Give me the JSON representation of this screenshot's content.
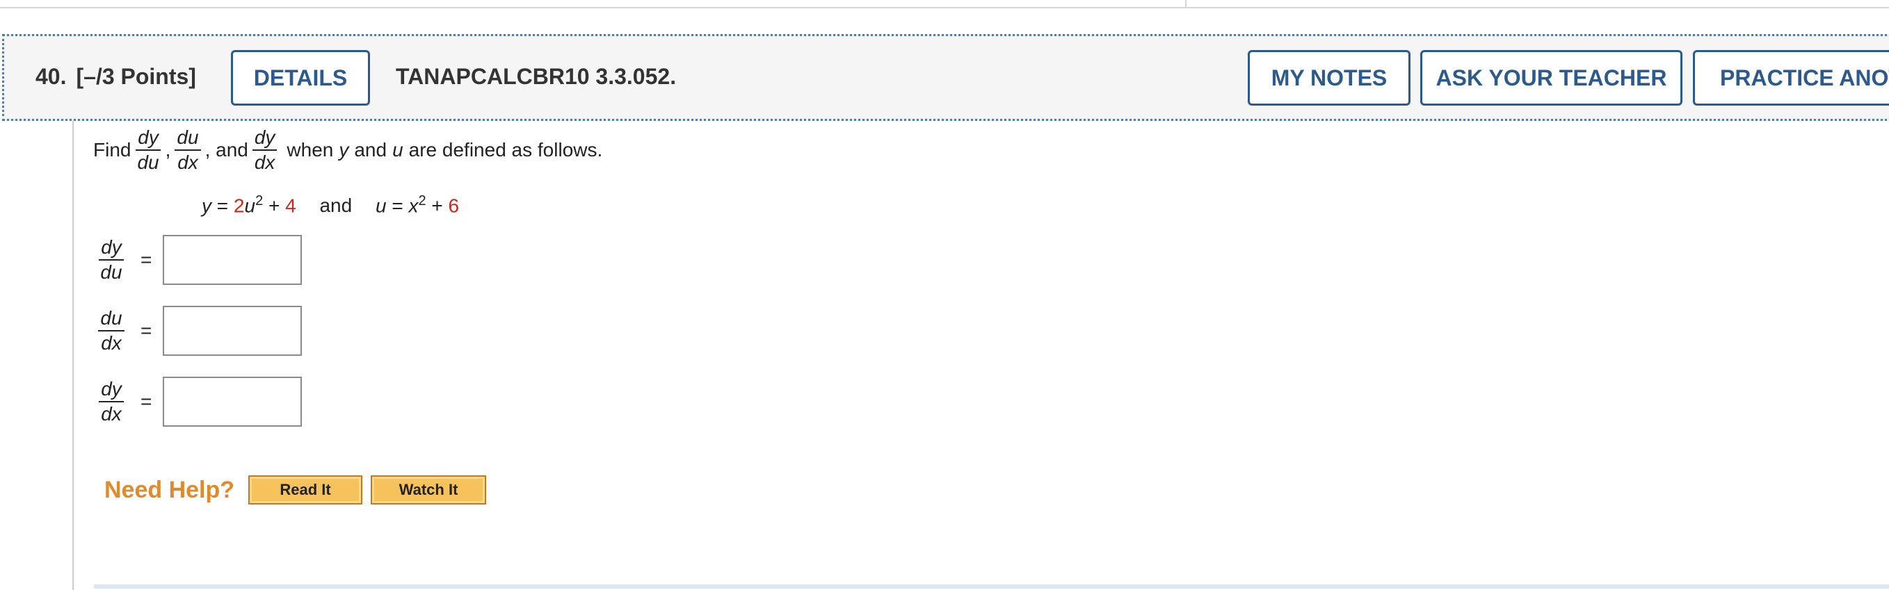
{
  "question": {
    "number": "40.",
    "points": "[–/3 Points]",
    "details_label": "DETAILS",
    "code": "TANAPCALCBR10 3.3.052.",
    "my_notes_label": "MY NOTES",
    "ask_teacher_label": "ASK YOUR TEACHER",
    "practice_label": "PRACTICE ANOT"
  },
  "statement": {
    "find": "Find",
    "f1_num": "dy",
    "f1_den": "du",
    "comma1": ",",
    "f2_num": "du",
    "f2_den": "dx",
    "comma2": ", and",
    "f3_num": "dy",
    "f3_den": "dx",
    "when": "when",
    "var_y": "y",
    "and": "and",
    "var_u": "u",
    "rest": "are defined as follows."
  },
  "equation": {
    "y_lhs": "y",
    "eq1": " = ",
    "coef": "2",
    "u_var": "u",
    "u_exp": "2",
    "plus1": " + ",
    "const1": "4",
    "and": "and",
    "u_lhs": "u",
    "eq2": " = ",
    "x_var": "x",
    "x_exp": "2",
    "plus2": " + ",
    "const2": "6"
  },
  "answers": [
    {
      "num": "dy",
      "den": "du",
      "eq": "=",
      "value": ""
    },
    {
      "num": "du",
      "den": "dx",
      "eq": "=",
      "value": ""
    },
    {
      "num": "dy",
      "den": "dx",
      "eq": "=",
      "value": ""
    }
  ],
  "help": {
    "label": "Need Help?",
    "read_it": "Read It",
    "watch_it": "Watch It"
  },
  "colors": {
    "accent_blue": "#2c5a8c",
    "dotted_border": "#3f7fc4",
    "header_bg": "#f5f5f5",
    "given_red": "#c8281f",
    "help_orange": "#e08a2e",
    "help_button": "#f6c25c"
  }
}
